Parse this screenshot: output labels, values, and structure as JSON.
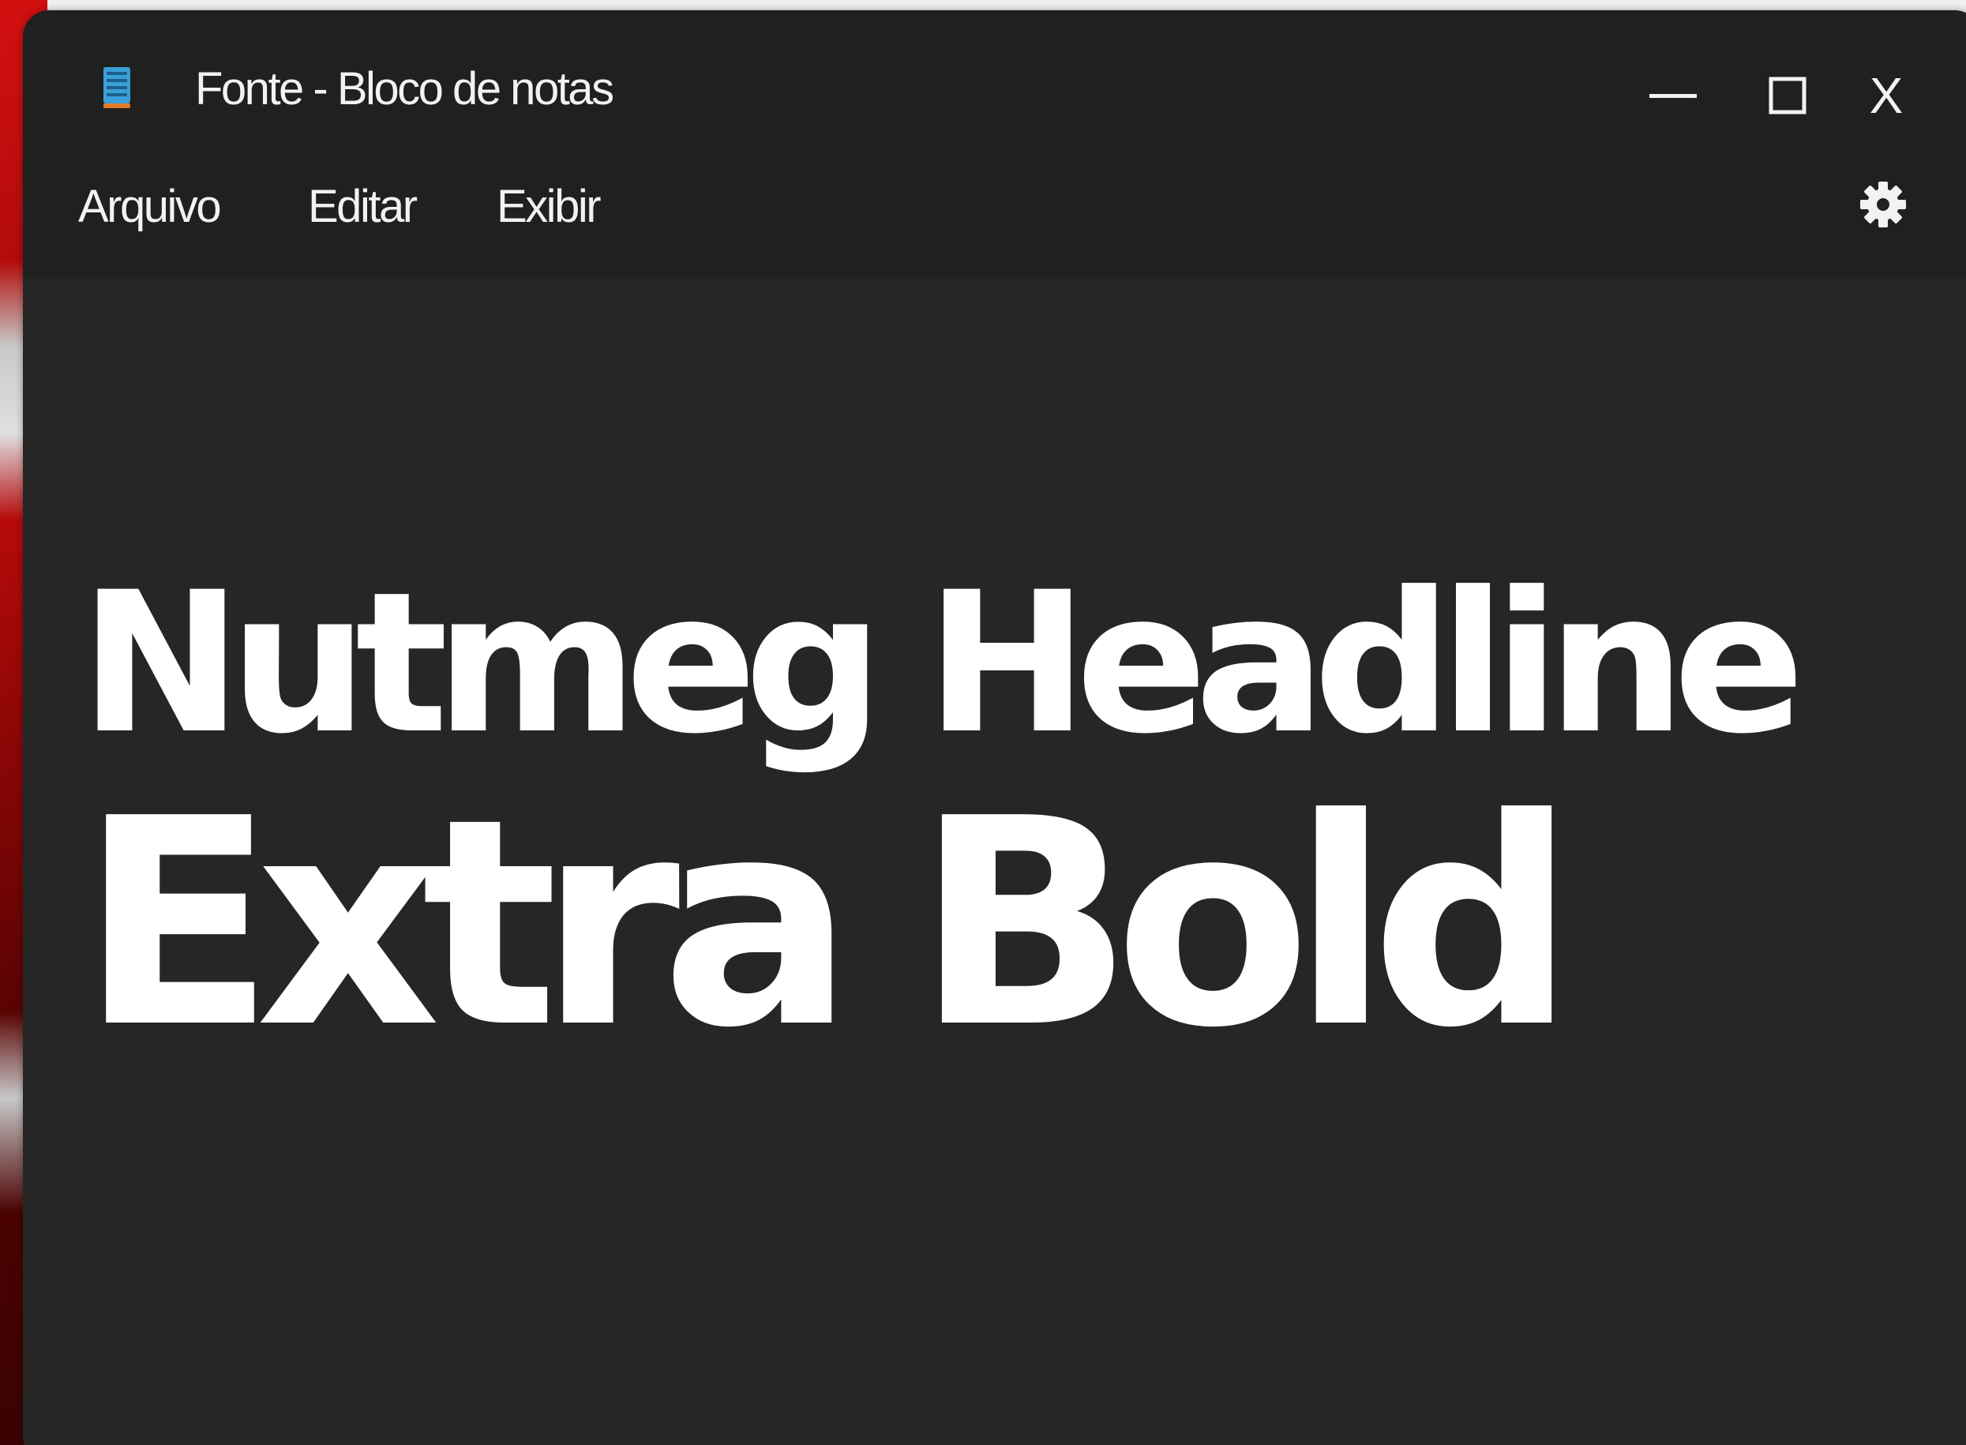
{
  "window": {
    "title": "Fonte - Bloco de notas",
    "app_icon": "notepad-icon",
    "controls": {
      "minimize_icon": "minimize-icon",
      "maximize_icon": "maximize-icon",
      "close_label": "X"
    }
  },
  "menu": {
    "items": [
      {
        "label": "Arquivo"
      },
      {
        "label": "Editar"
      },
      {
        "label": "Exibir"
      }
    ],
    "settings_icon": "gear-icon"
  },
  "document": {
    "lines": [
      "Nutmeg Headline",
      "Extra Bold"
    ]
  },
  "colors": {
    "titlebar": "#202020",
    "editor_background": "#262626",
    "text": "#ffffff"
  }
}
